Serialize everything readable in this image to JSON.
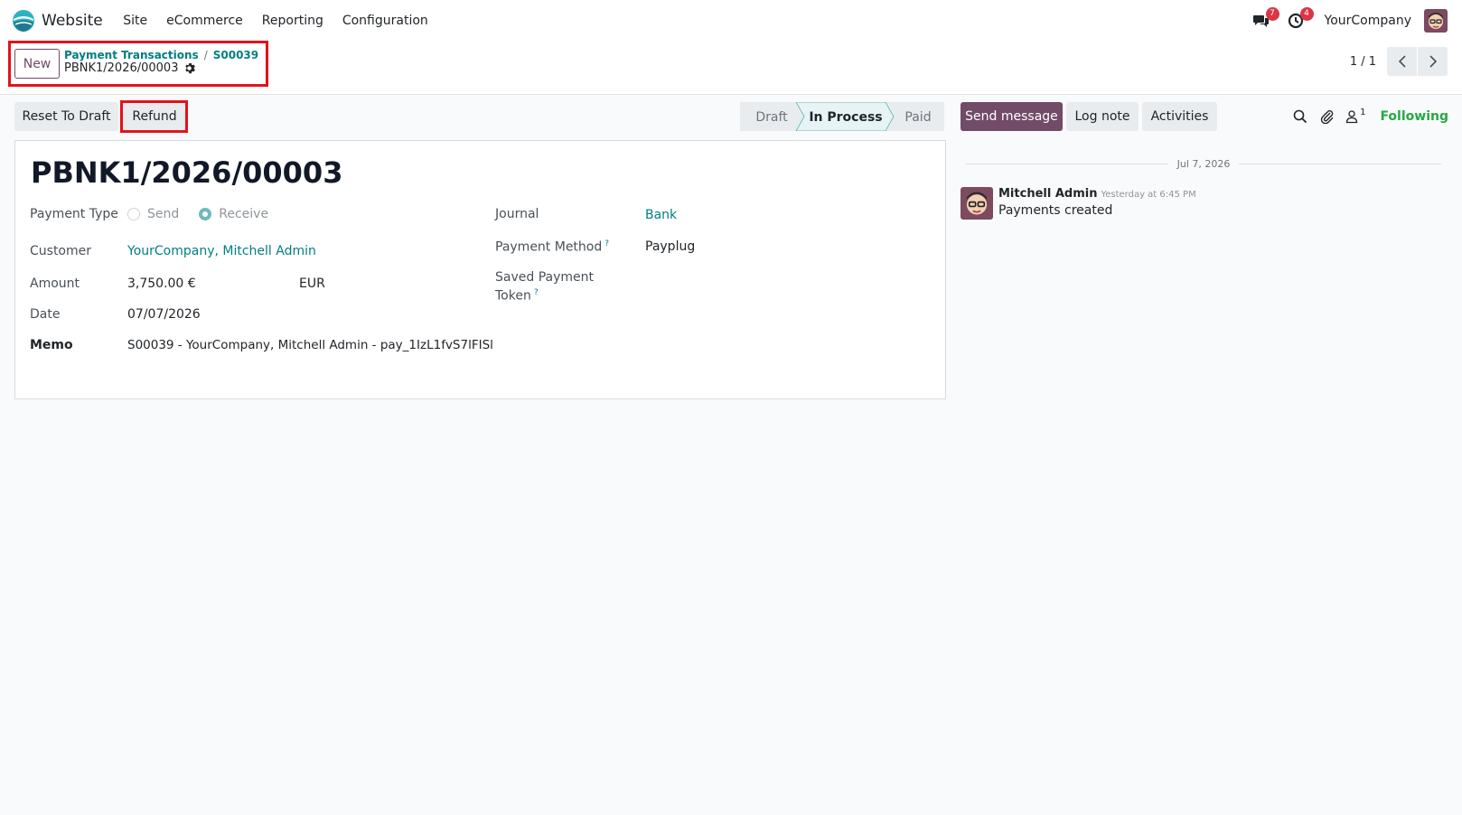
{
  "navbar": {
    "app_name": "Website",
    "menu": [
      "Site",
      "eCommerce",
      "Reporting",
      "Configuration"
    ],
    "messages_count": "7",
    "activities_count": "4",
    "company": "YourCompany"
  },
  "control_panel": {
    "new_label": "New",
    "breadcrumb": [
      "Payment Transactions",
      "S00039"
    ],
    "record_name": "PBNK1/2026/00003",
    "pager": "1 / 1"
  },
  "actions": {
    "reset_to_draft": "Reset To Draft",
    "refund": "Refund"
  },
  "statusbar": {
    "stages": [
      "Draft",
      "In Process",
      "Paid"
    ],
    "current": "In Process"
  },
  "form": {
    "title": "PBNK1/2026/00003",
    "payment_type_label": "Payment Type",
    "payment_type_options": [
      "Send",
      "Receive"
    ],
    "payment_type_selected": "Receive",
    "customer_label": "Customer",
    "customer_value": "YourCompany, Mitchell Admin",
    "amount_label": "Amount",
    "amount_value": "3,750.00 €",
    "currency_value": "EUR",
    "date_label": "Date",
    "date_value": "07/07/2026",
    "memo_label": "Memo",
    "memo_value": "S00039 - YourCompany, Mitchell Admin - pay_1IzL1fvS7lFISl",
    "journal_label": "Journal",
    "journal_value": "Bank",
    "payment_method_label": "Payment Method",
    "payment_method_value": "Payplug",
    "saved_token_label_1": "Saved Payment",
    "saved_token_label_2": "Token",
    "help_mark": "?"
  },
  "chatter": {
    "send_message": "Send message",
    "log_note": "Log note",
    "activities": "Activities",
    "followers_count": "1",
    "following": "Following",
    "date_separator": "Jul 7, 2026",
    "message": {
      "author": "Mitchell Admin",
      "time": "Yesterday at 6:45 PM",
      "text": "Payments created"
    }
  },
  "colors": {
    "brand": "#714b67",
    "link": "#017e84",
    "highlight": "#e3121a",
    "following": "#28a745"
  }
}
